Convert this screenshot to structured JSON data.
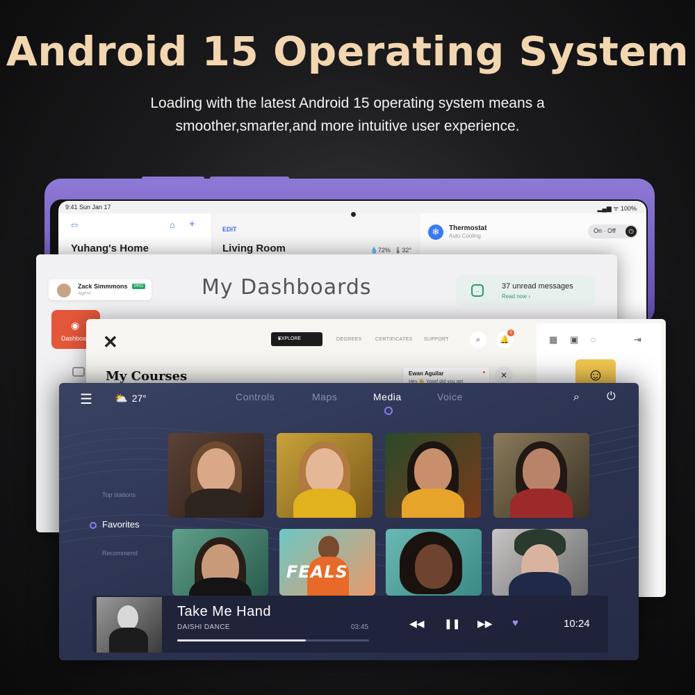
{
  "headline": "Android 15 Operating System",
  "subtitle_line1": "Loading with the latest Android 15 operating system means a",
  "subtitle_line2": "smoother,smarter,and more intuitive user experience.",
  "home_screen": {
    "status_time": "9:41  Sun Jan 17",
    "status_battery": "▂▄▆ ᯤ 100%",
    "home_title": "Yuhang's Home",
    "room_edit": "EDIT",
    "room_title": "Living Room",
    "room_humidity": "72%",
    "room_temp": "32°",
    "thermostat_name": "Thermostat",
    "thermostat_mode": "Auto Cooling",
    "toggle_label": "On · Off"
  },
  "dashboard": {
    "agent_name": "Zack Simmmons",
    "agent_badge": "PRO",
    "agent_role": "Agent",
    "title": "My Dashboards",
    "messages": "37 unread messages",
    "messages_link": "Read now  ›",
    "nav_label": "Dashboard"
  },
  "courses": {
    "explore": "EXPLORE",
    "nav": [
      "DEGREES",
      "CERTIFICATES",
      "SUPPORT"
    ],
    "notif_count": "2",
    "title": "My Courses",
    "chat_name": "Ewan Aguilar",
    "chat_message": "Hey 👋 Yosef did you get"
  },
  "media": {
    "temperature": "27°",
    "tabs": [
      "Controls",
      "Maps",
      "Media",
      "Voice"
    ],
    "active_tab": "Media",
    "side_items": [
      "Top stations",
      "Favorites",
      "Recommend"
    ],
    "album_label": "FEALS",
    "song_title": "Take Me Hand",
    "artist": "DAISHI DANCE",
    "duration": "03:45",
    "progress": 0.67,
    "clock": "10:24",
    "colors": {
      "accent": "#9a8cf4",
      "panel": "#2b3250"
    }
  }
}
